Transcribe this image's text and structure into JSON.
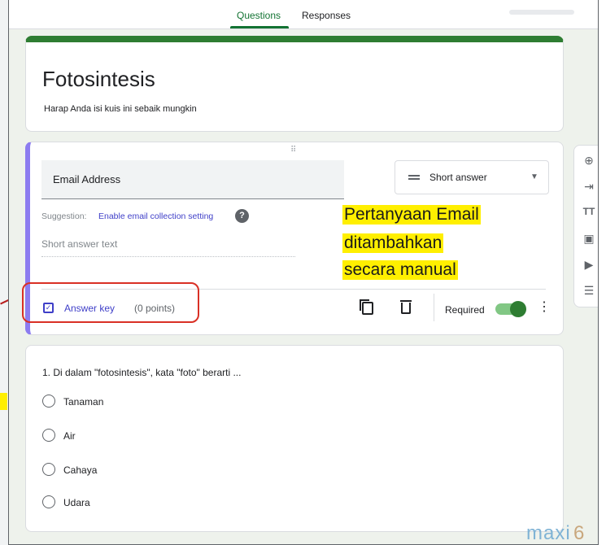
{
  "tabs": [
    {
      "label": "Questions",
      "active": true
    },
    {
      "label": "Responses",
      "active": false
    }
  ],
  "title_card": {
    "title": "Fotosintesis",
    "description": "Harap Anda isi kuis ini sebaik mungkin"
  },
  "question1": {
    "title_value": "Email Address",
    "type": "Short answer",
    "suggestion_label": "Suggestion:",
    "suggestion_link": "Enable email collection setting",
    "answer_placeholder": "Short answer text",
    "answer_key_label": "Answer key",
    "points": "(0 points)",
    "required_label": "Required",
    "required": true
  },
  "annotation": {
    "lines": [
      "Pertanyaan Email",
      "ditambahkan",
      "secara manual"
    ]
  },
  "side_toolbar": [
    "add-question",
    "import-questions",
    "add-title",
    "add-image",
    "add-video",
    "add-section"
  ],
  "question2": {
    "title": "1. Di dalam \"fotosintesis\", kata \"foto\" berarti ...",
    "options": [
      "Tanaman",
      "Air",
      "Cahaya",
      "Udara"
    ]
  },
  "watermark": {
    "text": "maxi",
    "suffix": "6"
  },
  "colors": {
    "theme_green": "#2e7d32",
    "question_accent": "#8c7cf0",
    "link_blue": "#3f3fc8",
    "highlight_yellow": "#ffef00",
    "callout_red": "#d93025"
  }
}
